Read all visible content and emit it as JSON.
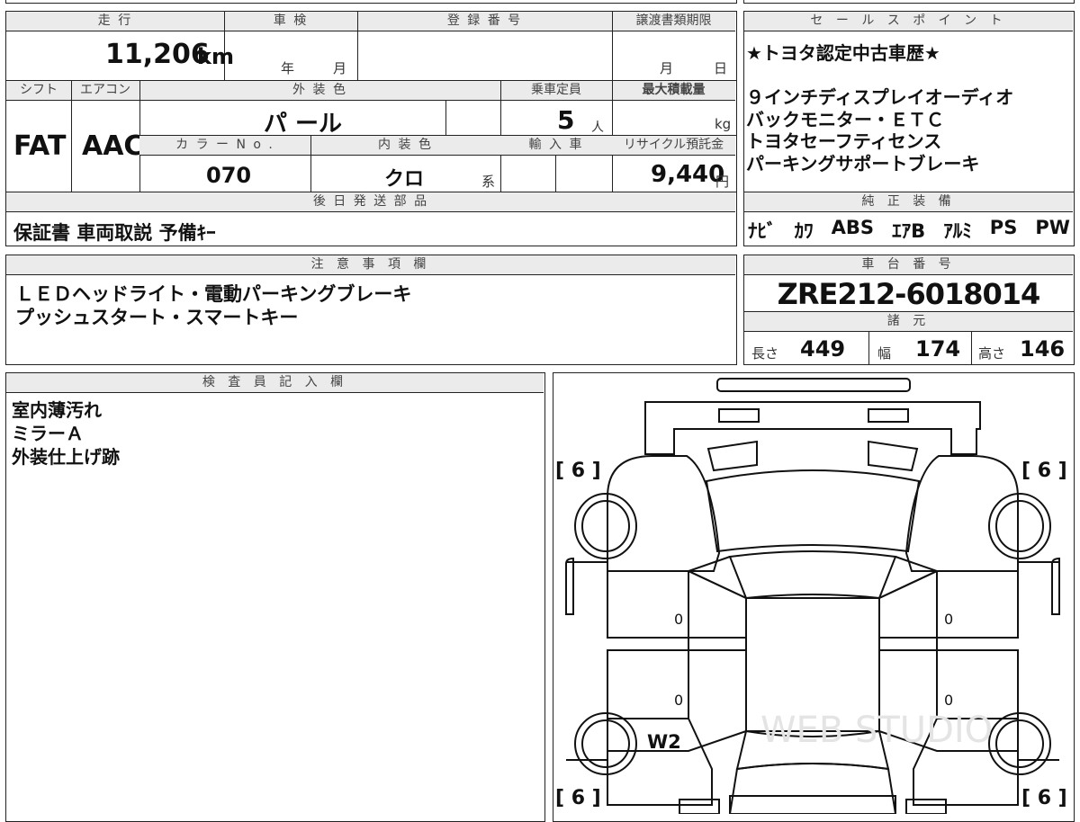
{
  "top_block": {
    "mileage": {
      "label": "走 行",
      "value": "11,206",
      "unit": "km"
    },
    "inspection": {
      "label": "車 検",
      "year_unit": "年",
      "month_unit": "月"
    },
    "registration": {
      "label": "登 録 番 号"
    },
    "transfer": {
      "label": "譲渡書類期限",
      "month_unit": "月",
      "day_unit": "日"
    },
    "shift": {
      "label": "シフト",
      "value": "FAT"
    },
    "aircon": {
      "label": "エアコン",
      "value": "AAC"
    },
    "exterior_color": {
      "label": "外 装 色",
      "value": "パ ール"
    },
    "capacity": {
      "label": "乗車定員",
      "value": "5",
      "unit": "人"
    },
    "max_load": {
      "label": "最大積載量",
      "unit": "kg"
    },
    "color_no": {
      "label": "カ ラ ー N o .",
      "value": "070"
    },
    "interior_color": {
      "label": "内 装 色",
      "value": "クロ",
      "unit": "系"
    },
    "import": {
      "label": "輸 入 車"
    },
    "recycle": {
      "label": "リサイクル預託金",
      "value": "9,440",
      "unit": "円"
    },
    "later_parts": {
      "label": "後 日 発 送 部 品",
      "value": "保証書 車両取説 予備ｷｰ"
    }
  },
  "sales_points": {
    "label": "セ ー ル ス ポ イ ン ト",
    "lines": [
      "★トヨタ認定中古車歴★",
      "",
      "９インチディスプレイオーディオ",
      "バックモニター・ＥＴＣ",
      "トヨタセーフティセンス",
      "パーキングサポートブレーキ"
    ]
  },
  "genuine_equipment": {
    "label": "純 正 装 備",
    "items": [
      "ﾅﾋﾞ",
      "ｶﾜ",
      "ABS",
      "ｴｱB",
      "ｱﾙﾐ",
      "PS",
      "PW"
    ]
  },
  "notes": {
    "label": "注 意 事 項 欄",
    "lines": [
      "ＬＥＤヘッドライト・電動パーキングブレーキ",
      "プッシュスタート・スマートキー"
    ]
  },
  "chassis": {
    "label": "車 台 番 号",
    "value": "ZRE212-6018014"
  },
  "specs": {
    "label": "諸 元",
    "length_label": "長さ",
    "length": "449",
    "width_label": "幅",
    "width": "174",
    "height_label": "高さ",
    "height": "146"
  },
  "inspector": {
    "label": "検 査 員 記 入 欄",
    "lines": [
      "室内薄汚れ",
      "ミラーＡ",
      "外装仕上げ跡"
    ]
  },
  "diagram": {
    "tire_fl": "[ 6 ]",
    "tire_fr": "[ 6 ]",
    "tire_rl": "[ 6 ]",
    "tire_rr": "[ 6 ]",
    "door_marks": [
      "0",
      "0",
      "0",
      "0"
    ],
    "damage": "W2",
    "watermark": "WEB STUDIO"
  }
}
